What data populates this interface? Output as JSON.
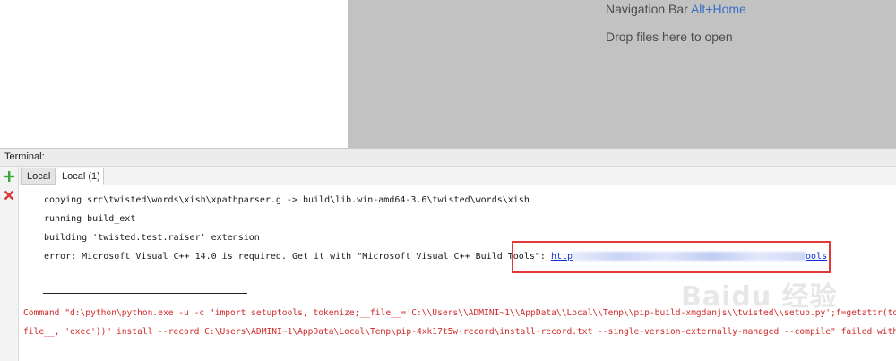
{
  "editor": {
    "hints": [
      {
        "label": "Navigation Bar ",
        "shortcut": "Alt+Home"
      },
      {
        "label": "Drop files here to open",
        "shortcut": ""
      }
    ]
  },
  "terminal": {
    "title": "Terminal:",
    "tabs": [
      {
        "label": "Local",
        "active": false
      },
      {
        "label": "Local (1)",
        "active": true
      }
    ],
    "gutter_icons": [
      "add-icon",
      "close-icon"
    ],
    "lines": [
      "copying src\\twisted\\words\\xish\\xpathparser.g -> build\\lib.win-amd64-3.6\\twisted\\words\\xish",
      "running build_ext",
      "building 'twisted.test.raiser' extension",
      "error: Microsoft Visual C++ 14.0 is required. Get it with \"Microsoft Visual C++ Build Tools\": "
    ],
    "link": {
      "start": "http",
      "end": "ools"
    },
    "command_lines": [
      "Command \"d:\\python\\python.exe -u -c \"import setuptools, tokenize;__file__='C:\\\\Users\\\\ADMINI~1\\\\AppData\\\\Local\\\\Temp\\\\pip-build-xmgdanjs\\\\twisted\\\\setup.py';f=getattr(tokenize, 'open', open)(__file__);",
      "file__, 'exec'))\" install --record C:\\Users\\ADMINI~1\\AppData\\Local\\Temp\\pip-4xk17t5w-record\\install-record.txt --single-version-externally-managed --compile\" failed with error code"
    ]
  },
  "colors": {
    "error_text": "#d02a2a",
    "link": "#0a2fd6",
    "highlight_box": "#e03a3a",
    "editor_background": "#c2c2c2",
    "shortcut": "#3a6fc4"
  },
  "watermark": {
    "text": "Baidu 经验"
  }
}
